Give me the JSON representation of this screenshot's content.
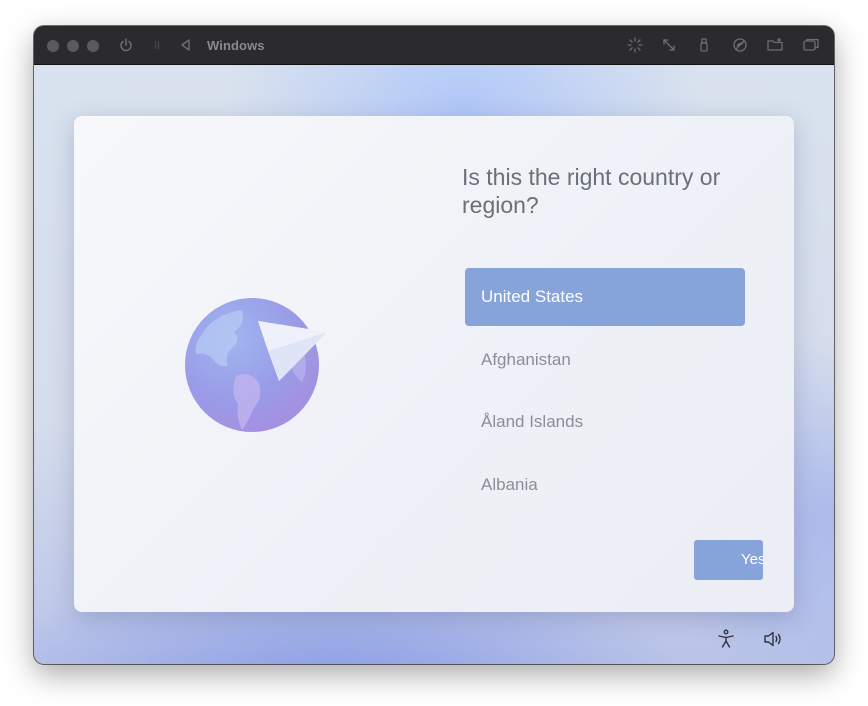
{
  "window": {
    "title": "Windows"
  },
  "toolbar_icons": [
    "power-icon",
    "pause-icon",
    "back-icon",
    "brightness-icon",
    "resize-icon",
    "usb-icon",
    "no-network-icon",
    "shared-folder-icon",
    "window-switch-icon"
  ],
  "oobe": {
    "heading": "Is this the right country or region?",
    "countries": [
      {
        "label": "United States",
        "selected": true
      },
      {
        "label": "Afghanistan",
        "selected": false
      },
      {
        "label": "Åland Islands",
        "selected": false
      },
      {
        "label": "Albania",
        "selected": false
      }
    ],
    "yes_label": "Yes"
  },
  "taskbar": {
    "icons": [
      "accessibility-icon",
      "volume-icon"
    ]
  },
  "colors": {
    "accent": "#86a3da",
    "titlebar": "#2b2b2d",
    "heading_text": "#6b6f7a"
  }
}
